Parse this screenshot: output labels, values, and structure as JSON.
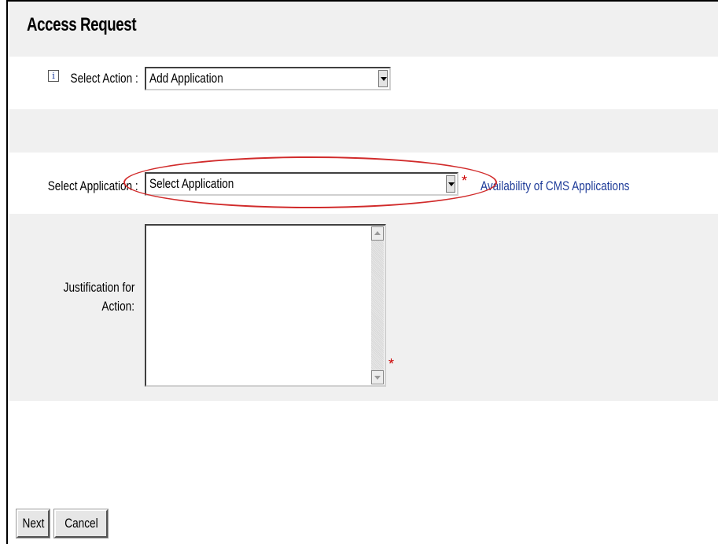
{
  "header": {
    "title": "Access Request"
  },
  "action": {
    "label": "Select Action :",
    "value": "Add Application"
  },
  "application": {
    "label": "Select Application :",
    "value": "Select Application",
    "required_mark": "*",
    "link_text": "Availability of CMS Applications"
  },
  "justification": {
    "label_line1": "Justification for",
    "label_line2": "Action:",
    "value": "",
    "required_mark": "*"
  },
  "buttons": {
    "next": "Next",
    "cancel": "Cancel"
  },
  "colors": {
    "annotation": "#d12b2b",
    "link": "#1f3c99",
    "required": "#cc0000",
    "band": "#f0f0f0"
  },
  "icons": {
    "info": "info-icon",
    "dropdown": "chevron-down-icon"
  }
}
